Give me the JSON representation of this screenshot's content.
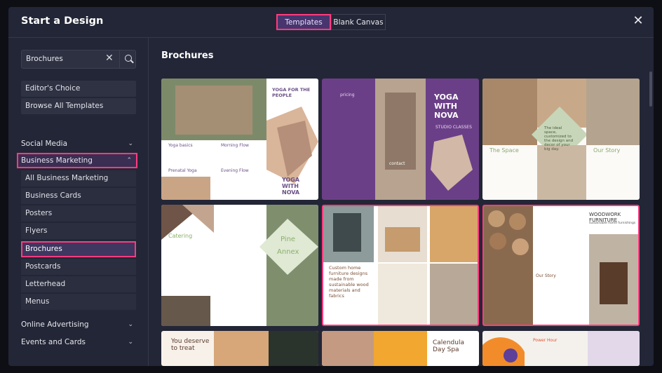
{
  "header": {
    "title": "Start a Design",
    "tabs": [
      {
        "label": "Templates",
        "active": true
      },
      {
        "label": "Blank Canvas",
        "active": false
      }
    ],
    "close_icon": "close-icon"
  },
  "sidebar": {
    "search": {
      "value": "Brochures"
    },
    "quick": [
      "Editor's Choice",
      "Browse All Templates"
    ],
    "categories": [
      {
        "label": "Social Media",
        "expanded": false
      },
      {
        "label": "Business Marketing",
        "expanded": true
      },
      {
        "label": "Online Advertising",
        "expanded": false
      },
      {
        "label": "Events and Cards",
        "expanded": false
      }
    ],
    "subitems": [
      "All Business Marketing",
      "Business Cards",
      "Posters",
      "Flyers",
      "Brochures",
      "Postcards",
      "Letterhead",
      "Menus"
    ],
    "selected_subitem": "Brochures"
  },
  "main": {
    "section_title": "Brochures",
    "templates": [
      {
        "texts": [
          "YOGA FOR THE PEOPLE",
          "Yoga basics",
          "Morning Flow",
          "Prenatal Yoga",
          "Evening Flow",
          "YOGA WITH NOVA"
        ]
      },
      {
        "texts": [
          "pricing",
          "YOGA WITH NOVA",
          "STUDIO CLASSES",
          "contact"
        ]
      },
      {
        "texts": [
          "The ideal space, customized to the design and decor of your big day.",
          "The Space",
          "Our Story"
        ]
      },
      {
        "texts": [
          "Catering",
          "Pine",
          "Annex"
        ]
      },
      {
        "texts": [
          "Custom home furniture designs made from sustainable wood materials and fabrics"
        ]
      },
      {
        "texts": [
          "WOODWORK FURNITURE",
          "sustainable home furnishings",
          "Our Story",
          "(123) 123-1234",
          "woodworkfurniture.co"
        ]
      },
      {
        "texts": [
          "You deserve to treat"
        ]
      },
      {
        "texts": [
          "Calendula Day Spa"
        ]
      },
      {
        "texts": [
          "Power Hour"
        ]
      }
    ]
  },
  "colors": {
    "accent": "#ff3b7f",
    "panel": "#232636",
    "yoga_purple": "#6b3f87"
  }
}
